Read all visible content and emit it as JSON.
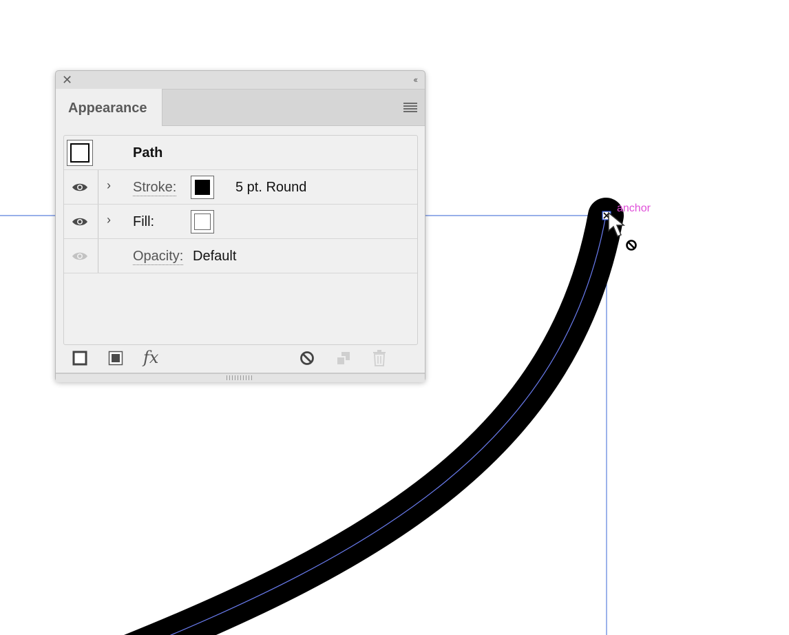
{
  "canvas": {
    "smart_guide_label": "anchor",
    "guide_color": "#5b7fdc",
    "smart_guide_color": "#e04fd9"
  },
  "panel": {
    "title": "Appearance",
    "header_item": {
      "label": "Path",
      "swatch": "path-icon"
    },
    "rows": [
      {
        "label": "Stroke:",
        "swatch_color": "#000000",
        "value": "5 pt. Round",
        "visible": true
      },
      {
        "label": "Fill:",
        "swatch_color": "#ffffff",
        "value": "",
        "visible": true
      },
      {
        "label": "Opacity:",
        "value": "Default",
        "visible": false
      }
    ],
    "footer_icons": [
      "add-stroke-icon",
      "add-fill-icon",
      "fx-icon",
      "clear-appearance-icon",
      "duplicate-item-icon",
      "delete-item-icon"
    ],
    "fx_label": "fx"
  }
}
